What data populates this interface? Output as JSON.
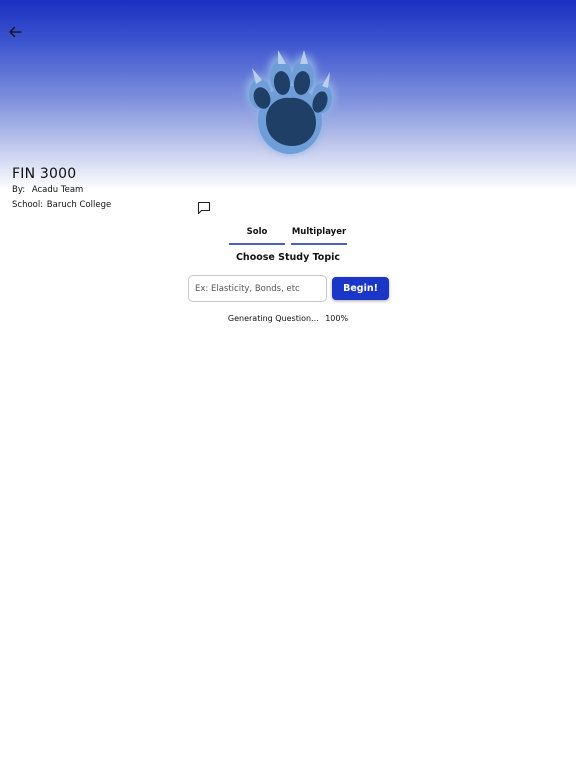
{
  "course": {
    "title": "FIN 3000",
    "by_label": "By:",
    "author": "Acadu Team",
    "school_label": "School:",
    "school": "Baruch College"
  },
  "icons": {
    "back": "arrow-left-icon",
    "logo": "bear-paw-icon",
    "chat": "chat-bubble-icon"
  },
  "colors": {
    "hero_top": "#1b2fc1",
    "accent": "#1b36c7",
    "tab_underline": "#4a60c7",
    "paw": "#1f3f66"
  },
  "tabs": [
    {
      "label": "Solo"
    },
    {
      "label": "Multiplayer"
    }
  ],
  "study": {
    "heading": "Choose Study Topic",
    "input_placeholder": "Ex: Elasticity, Bonds, etc",
    "input_value": "",
    "begin_label": "Begin!"
  },
  "status": {
    "text": "Generating Question...",
    "progress": "100%"
  }
}
